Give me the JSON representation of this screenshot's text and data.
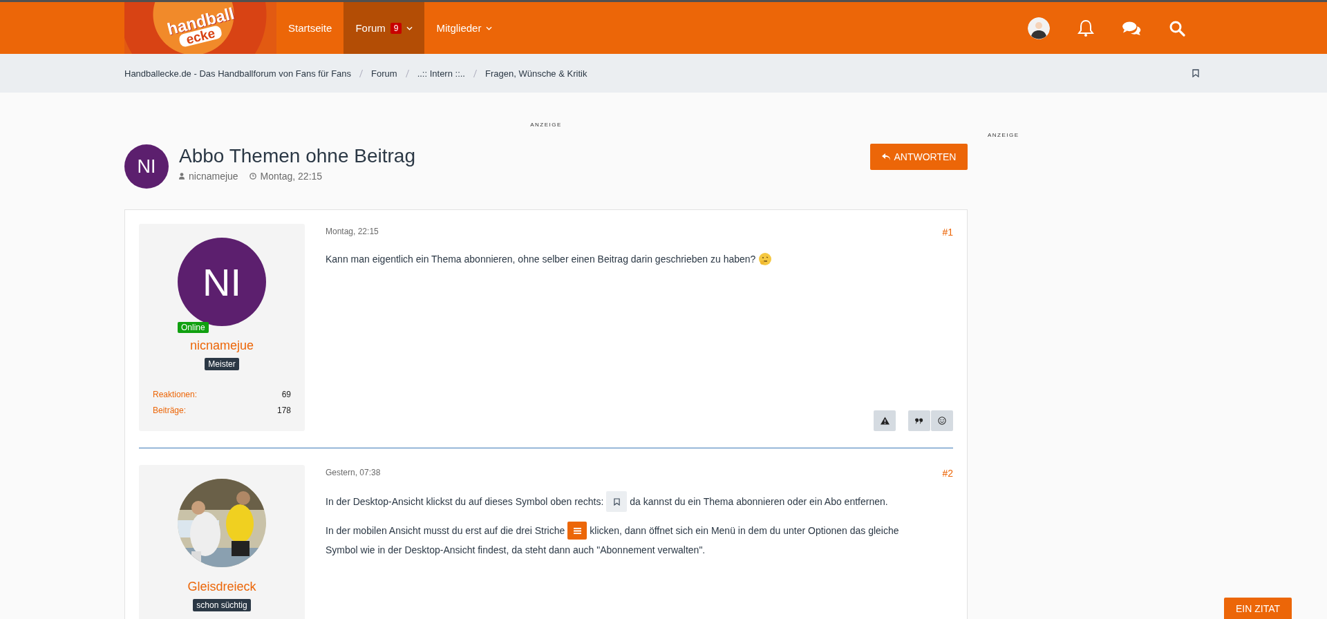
{
  "header": {
    "logo": {
      "line_1": "handball",
      "line_2": "ecke"
    },
    "nav": [
      {
        "label": "Startseite",
        "selected": false,
        "dropdown": false
      },
      {
        "label": "Forum",
        "selected": true,
        "badge": "9",
        "dropdown": true
      },
      {
        "label": "Mitglieder",
        "selected": false,
        "dropdown": true
      }
    ]
  },
  "breadcrumb": [
    "Handballecke.de - Das Handballforum von Fans für Fans",
    "Forum",
    "..:: Intern ::..",
    "Fragen, Wünsche & Kritik"
  ],
  "ad_label_top": "ANZEIGE",
  "thread": {
    "avatar_initials": "NI",
    "title": "Abbo Themen ohne Beitrag",
    "author": "nicnamejue",
    "date": "Montag, 22:15",
    "reply_button": "ANTWORTEN"
  },
  "ad_label_side": "ANZEIGE",
  "posts": [
    {
      "avatar": {
        "kind": "initials",
        "initials": "NI"
      },
      "status": "Online",
      "username": "nicnamejue",
      "rank": "Meister",
      "stats": [
        {
          "label": "Reaktionen:",
          "value": "69"
        },
        {
          "label": "Beiträge:",
          "value": "178"
        }
      ],
      "date": "Montag, 22:15",
      "number": "#1",
      "paragraphs": [
        [
          {
            "kind": "text",
            "text": "Kann man eigentlich ein Thema abonnieren, ohne selber einen Beitrag darin geschrieben zu haben?"
          },
          {
            "kind": "emoji"
          }
        ]
      ],
      "actions": true
    },
    {
      "avatar": {
        "kind": "picture"
      },
      "username": "Gleisdreieck",
      "rank": "schon süchtig",
      "date": "Gestern, 07:38",
      "number": "#2",
      "paragraphs": [
        [
          {
            "kind": "text",
            "text": "In der Desktop-Ansicht klickst du auf dieses Symbol oben rechts:"
          },
          {
            "kind": "bookmark"
          },
          {
            "kind": "text",
            "text": "da kannst du ein Thema abonnieren oder ein Abo entfernen."
          }
        ],
        [
          {
            "kind": "text",
            "text": "In der mobilen Ansicht musst du erst auf die drei Striche"
          },
          {
            "kind": "menu"
          },
          {
            "kind": "text",
            "text": "klicken, dann öffnet sich ein Menü in dem du unter Optionen das gleiche"
          },
          {
            "kind": "text",
            "text": "Symbol wie in der Desktop-Ansicht findest, da steht dann auch \"Abonnement verwalten\"."
          }
        ]
      ]
    }
  ],
  "quote_button": "EIN ZITAT"
}
